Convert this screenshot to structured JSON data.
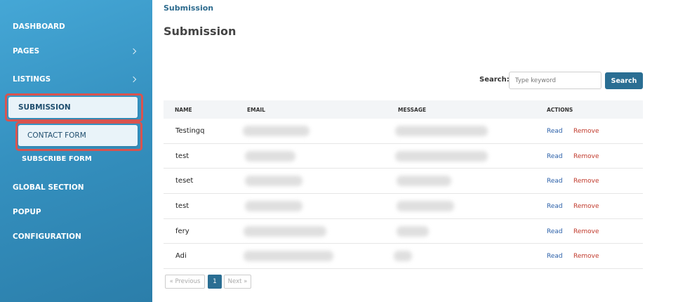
{
  "sidebar": {
    "items": [
      {
        "label": "DASHBOARD"
      },
      {
        "label": "PAGES"
      },
      {
        "label": "LISTINGS"
      },
      {
        "label": "SUBMISSION"
      },
      {
        "label": "GLOBAL SECTION"
      },
      {
        "label": "POPUP"
      },
      {
        "label": "CONFIGURATION"
      }
    ],
    "subitems": [
      {
        "label": "CONTACT FORM"
      },
      {
        "label": "SUBSCRIBE FORM"
      }
    ]
  },
  "main": {
    "breadcrumb": "Submission",
    "title": "Submission",
    "search": {
      "label": "Search:",
      "placeholder": "Type keyword",
      "button": "Search"
    },
    "table": {
      "headers": [
        "NAME",
        "EMAIL",
        "MESSAGE",
        "ACTIONS"
      ],
      "rows": [
        {
          "name": "Testingq"
        },
        {
          "name": "test"
        },
        {
          "name": "teset"
        },
        {
          "name": "test"
        },
        {
          "name": "fery"
        },
        {
          "name": "Adi"
        }
      ],
      "read_label": "Read",
      "remove_label": "Remove"
    },
    "pagination": {
      "prev": "« Previous",
      "page": "1",
      "next": "Next »"
    }
  },
  "colors": {
    "accent": "#2a6e93",
    "sidebar": "#3591c0",
    "highlight": "#d9534f",
    "read": "#2a5fa8",
    "remove": "#c0392b"
  }
}
